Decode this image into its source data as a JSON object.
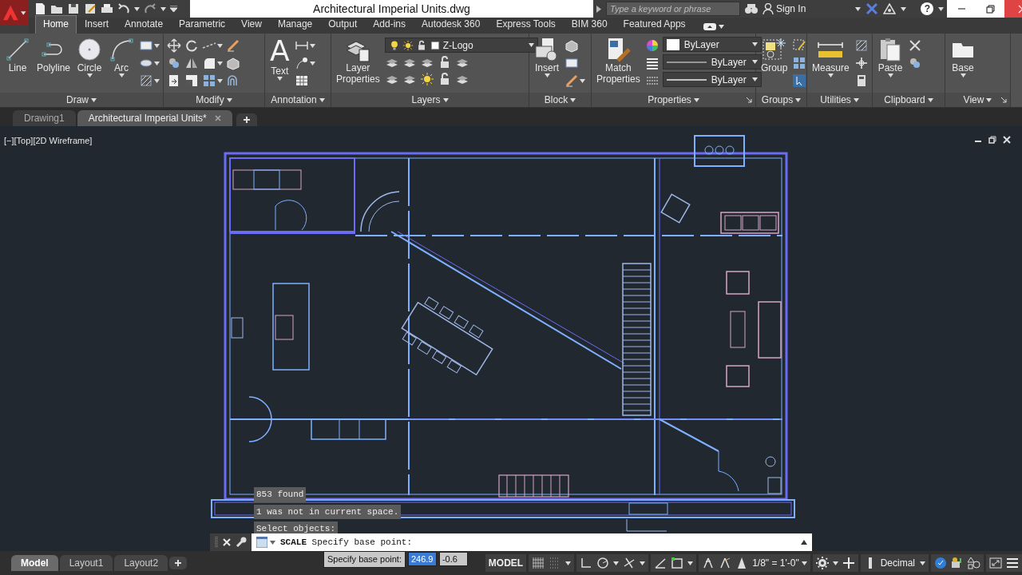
{
  "title_bar": {
    "title": "Architectural Imperial Units.dwg",
    "search": {
      "placeholder": "Type a keyword or phrase"
    },
    "sign_in": "Sign In",
    "help": "?"
  },
  "ribbon_tabs": [
    {
      "label": "Home",
      "selected": true
    },
    {
      "label": "Insert",
      "selected": false
    },
    {
      "label": "Annotate",
      "selected": false
    },
    {
      "label": "Parametric",
      "selected": false
    },
    {
      "label": "View",
      "selected": false
    },
    {
      "label": "Manage",
      "selected": false
    },
    {
      "label": "Output",
      "selected": false
    },
    {
      "label": "Add-ins",
      "selected": false
    },
    {
      "label": "Autodesk 360",
      "selected": false
    },
    {
      "label": "Express Tools",
      "selected": false
    },
    {
      "label": "BIM 360",
      "selected": false
    },
    {
      "label": "Featured Apps",
      "selected": false
    }
  ],
  "panels": [
    {
      "title": "Draw",
      "tools": [
        {
          "label": "Line",
          "dropdown": false
        },
        {
          "label": "Polyline",
          "dropdown": false
        },
        {
          "label": "Circle",
          "dropdown": true
        },
        {
          "label": "Arc",
          "dropdown": true
        }
      ]
    },
    {
      "title": "Modify"
    },
    {
      "title": "Annotation",
      "tools": [
        {
          "label": "Text",
          "dropdown": true,
          "glyph": "A"
        }
      ]
    },
    {
      "title": "Layers",
      "tools": [
        {
          "label": "Layer Properties",
          "dropdown": false
        }
      ],
      "layer_dropdown": "Z-Logo"
    },
    {
      "title": "Block",
      "tools": [
        {
          "label": "Insert",
          "dropdown": true
        }
      ]
    },
    {
      "title": "Properties",
      "tools": [
        {
          "label": "Match Properties",
          "dropdown": false
        }
      ],
      "launcher": true,
      "dropdowns": [
        {
          "kind": "color",
          "value": "ByLayer"
        },
        {
          "kind": "linetype",
          "value": "ByLayer"
        },
        {
          "kind": "lineweight",
          "value": "ByLayer"
        }
      ]
    },
    {
      "title": "Groups",
      "tools": [
        {
          "label": "Group",
          "dropdown": false
        }
      ]
    },
    {
      "title": "Utilities",
      "tools": [
        {
          "label": "Measure",
          "dropdown": true
        }
      ]
    },
    {
      "title": "Clipboard",
      "tools": [
        {
          "label": "Paste",
          "dropdown": true
        }
      ]
    },
    {
      "title": "View",
      "tools": [
        {
          "label": "Base",
          "dropdown": true
        }
      ],
      "launcher": true
    }
  ],
  "file_tabs": [
    {
      "label": "Drawing1",
      "selected": false
    },
    {
      "label": "Architectural Imperial Units*",
      "selected": true
    }
  ],
  "viewport_label": "[−][Top][2D Wireframe]",
  "command_history": [
    "853 found",
    "1 was not in current space.",
    "Select objects:"
  ],
  "command_line": "**SCALE** Specify base point:",
  "dynamic_input": {
    "prompt": "Specify base point:",
    "fields": [
      {
        "value": "246.9",
        "selected": true
      },
      {
        "value": "-0.6",
        "selected": false
      }
    ]
  },
  "layout_tabs": [
    {
      "label": "Model",
      "selected": true
    },
    {
      "label": "Layout1",
      "selected": false
    },
    {
      "label": "Layout2",
      "selected": false
    }
  ],
  "status_bar": {
    "space": "MODEL",
    "scale": "1/8\" = 1'-0\"",
    "units": "Decimal"
  }
}
